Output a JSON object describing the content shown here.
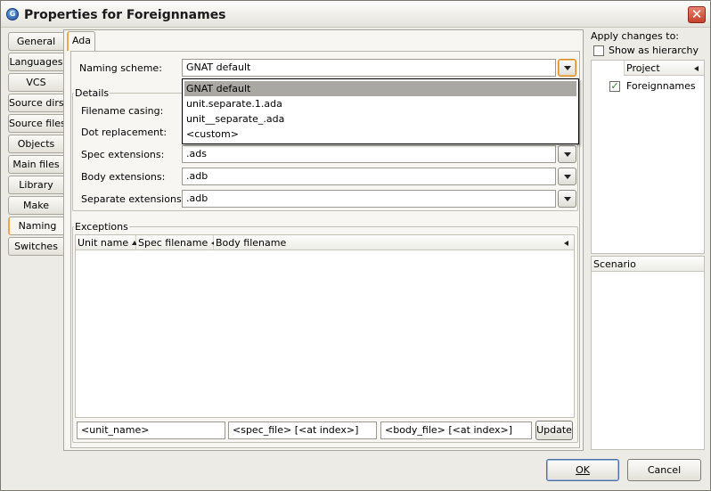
{
  "window": {
    "title": "Properties for Foreignnames",
    "close_glyph": "✕"
  },
  "side_tabs": [
    {
      "label": "General"
    },
    {
      "label": "Languages"
    },
    {
      "label": "VCS"
    },
    {
      "label": "Source dirs"
    },
    {
      "label": "Source files"
    },
    {
      "label": "Objects"
    },
    {
      "label": "Main files"
    },
    {
      "label": "Library"
    },
    {
      "label": "Make"
    },
    {
      "label": "Naming"
    },
    {
      "label": "Switches"
    }
  ],
  "active_tab": "Naming",
  "content_tab": "Ada",
  "naming": {
    "scheme_label": "Naming scheme:",
    "scheme_value": "GNAT default",
    "details_title": "Details",
    "filename_casing_label": "Filename casing:",
    "dot_replacement_label": "Dot replacement:",
    "spec_ext_label": "Spec extensions:",
    "spec_ext_value": ".ads",
    "body_ext_label": "Body extensions:",
    "body_ext_value": ".adb",
    "separate_ext_label": "Separate extensions:",
    "separate_ext_value": ".adb"
  },
  "dropdown": {
    "options": [
      "GNAT default",
      "unit.separate.1.ada",
      "unit__separate_.ada",
      "<custom>"
    ],
    "selected": "GNAT default"
  },
  "exceptions": {
    "title": "Exceptions",
    "columns": [
      "Unit name",
      "Spec filename",
      "Body filename"
    ],
    "unit_placeholder": "<unit_name>",
    "spec_placeholder": "<spec_file> [<at index>]",
    "body_placeholder": "<body_file> [<at index>]",
    "update_label": "Update"
  },
  "apply": {
    "title": "Apply changes to:",
    "hierarchy_label": "Show as hierarchy",
    "project_header": "Project",
    "project_item": "Foreignnames",
    "scenario_header": "Scenario"
  },
  "footer": {
    "ok_label": "OK",
    "cancel_label": "Cancel"
  },
  "colors": {
    "accent_tab": "#f0a650",
    "check_green": "#2f8a2a",
    "close_red": "#c4402b"
  }
}
